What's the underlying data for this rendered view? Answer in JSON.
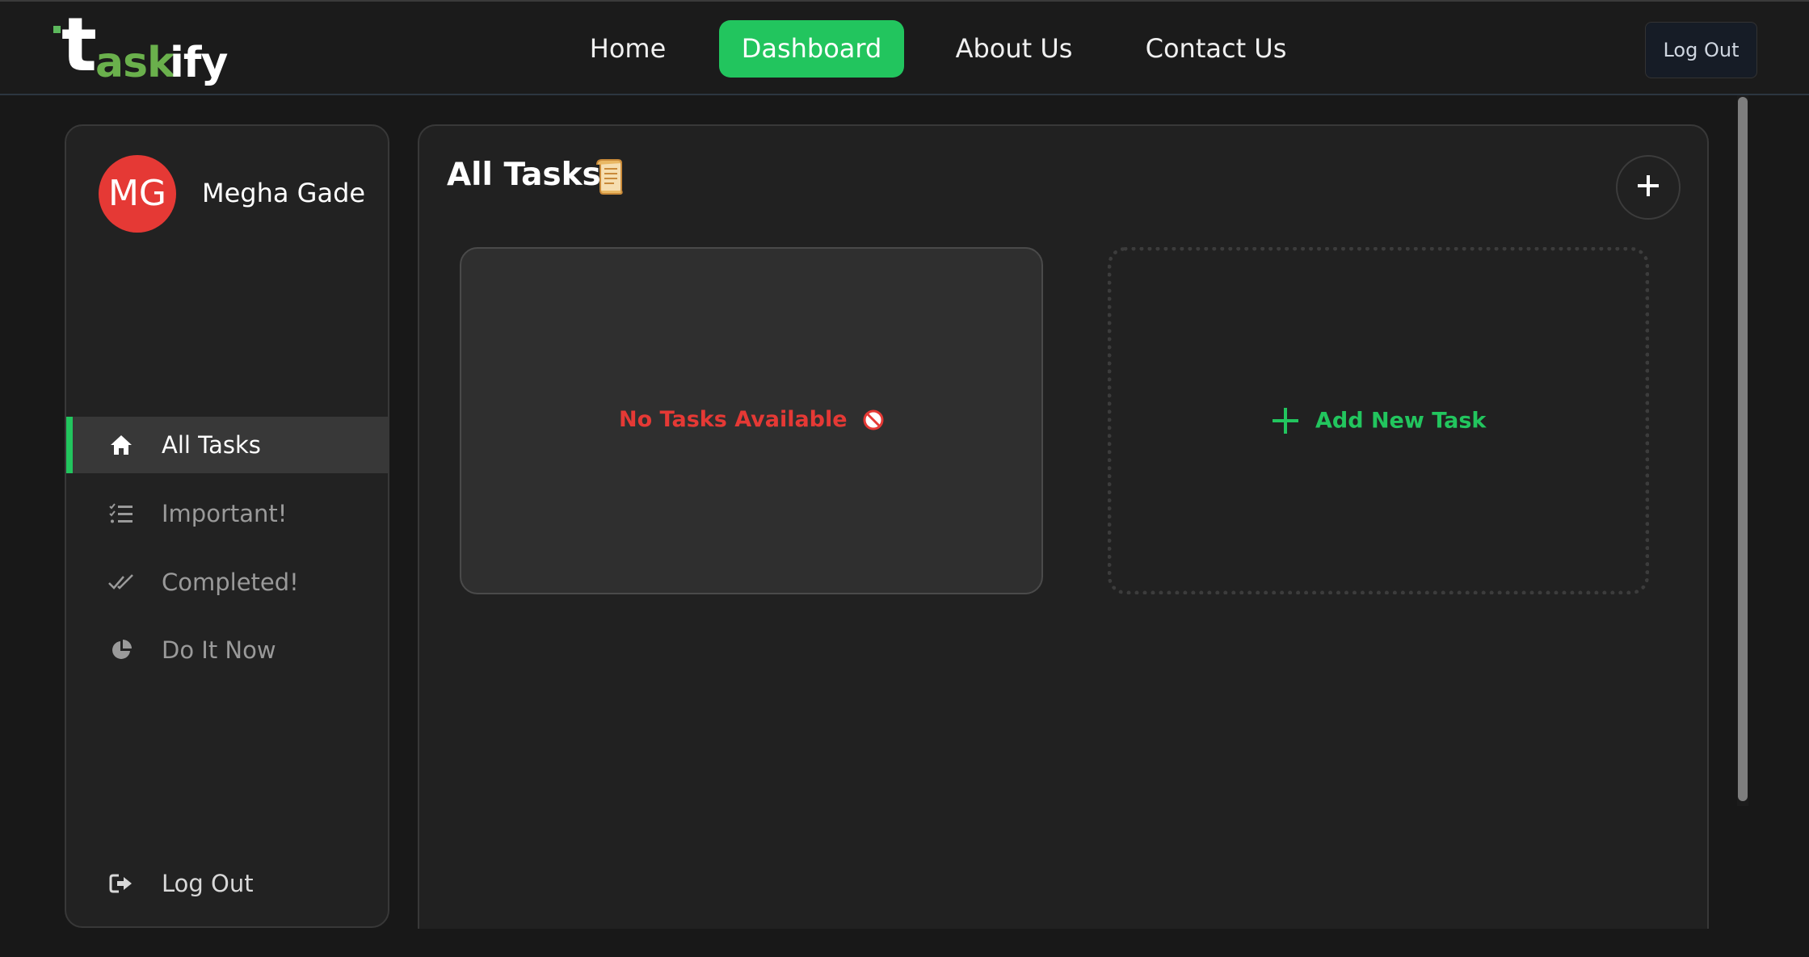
{
  "brand": {
    "logo_t": "t",
    "logo_ask": "ask",
    "logo_ify": "ify",
    "accent": "#22c55e",
    "logo_green": "#6ab04c"
  },
  "nav": {
    "home": "Home",
    "dashboard": "Dashboard",
    "about": "About Us",
    "contact": "Contact Us",
    "logout": "Log Out",
    "active": "Dashboard"
  },
  "user": {
    "initials": "MG",
    "name": "Megha Gade",
    "avatar_color": "#e53935"
  },
  "sidebar": {
    "items": [
      {
        "label": "All Tasks",
        "icon": "home-icon",
        "active": true
      },
      {
        "label": "Important!",
        "icon": "list-check-icon",
        "active": false
      },
      {
        "label": "Completed!",
        "icon": "double-check-icon",
        "active": false
      },
      {
        "label": "Do It Now",
        "icon": "pie-chart-icon",
        "active": false
      }
    ],
    "logout": {
      "label": "Log Out",
      "icon": "sign-out-icon"
    }
  },
  "main": {
    "title": "All Tasks",
    "title_icon": "scroll-icon",
    "empty_message": "No Tasks Available",
    "empty_icon": "prohibited-icon",
    "empty_color": "#e53935",
    "add_task_label": "Add New Task",
    "add_icon": "plus-icon"
  }
}
